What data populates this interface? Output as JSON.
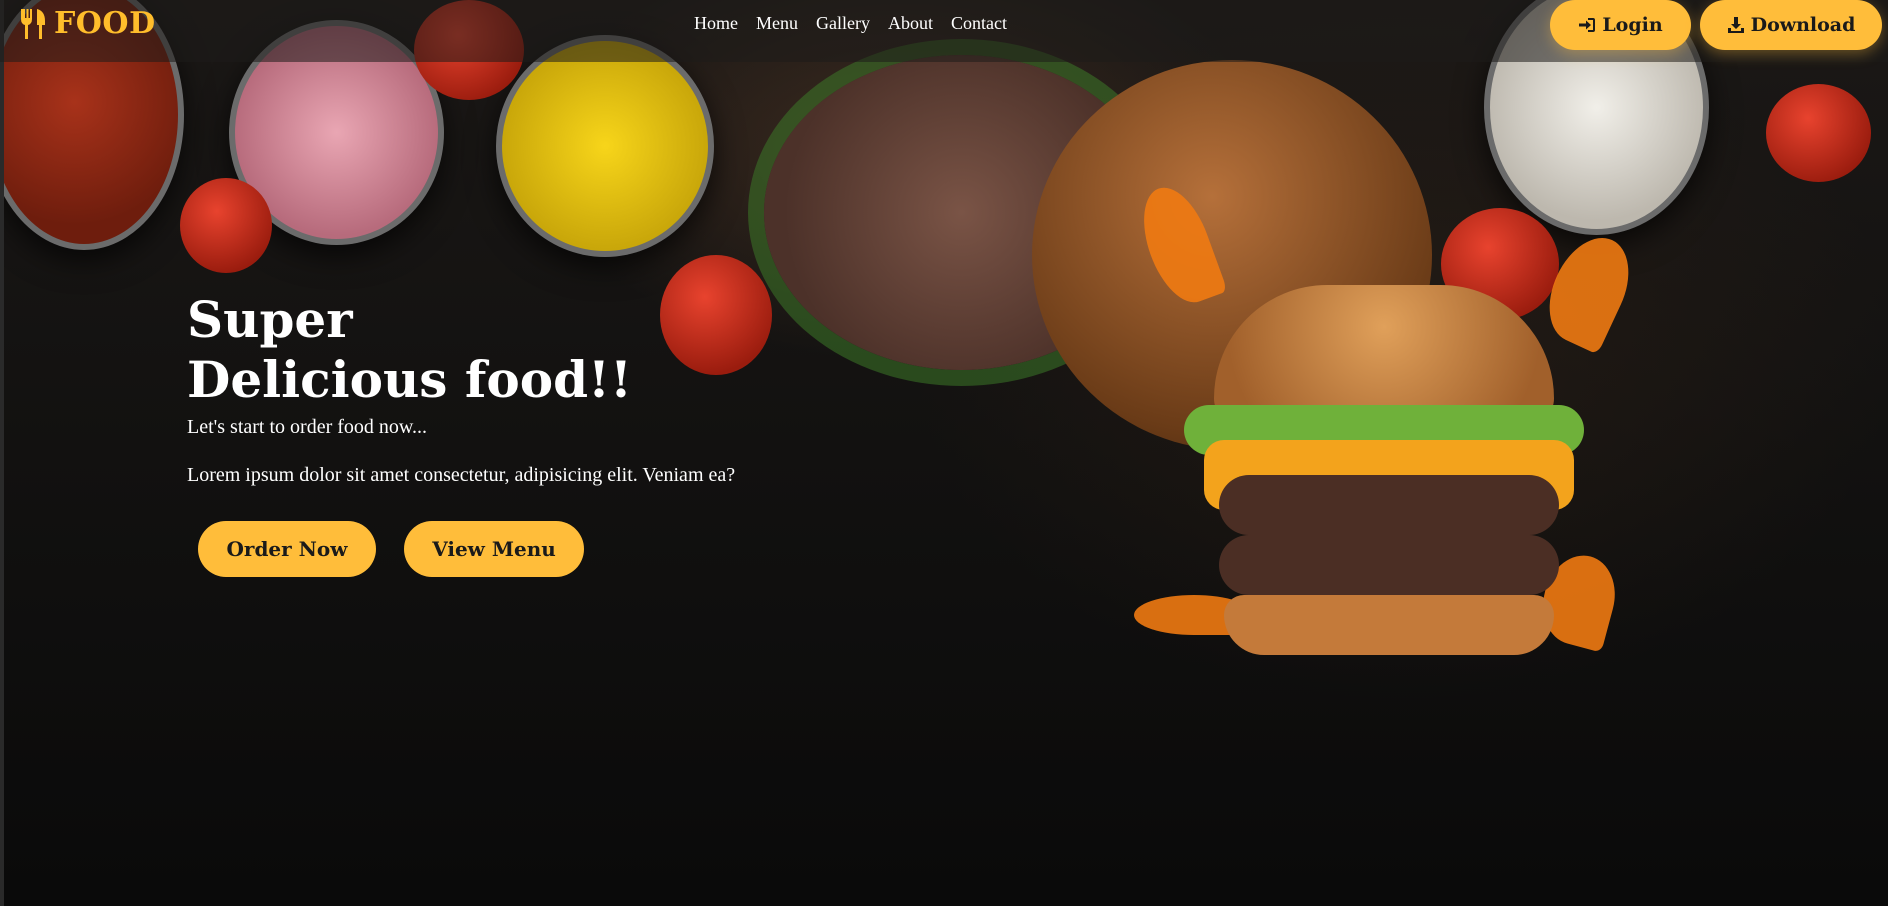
{
  "brand": {
    "name": "FOOD",
    "icon": "utensils-icon",
    "color": "#ffbd2b"
  },
  "nav": {
    "links": [
      {
        "label": "Home"
      },
      {
        "label": "Menu"
      },
      {
        "label": "Gallery"
      },
      {
        "label": "About"
      },
      {
        "label": "Contact"
      }
    ],
    "login_label": "Login",
    "login_icon": "sign-in-icon",
    "download_label": "Download",
    "download_icon": "download-icon"
  },
  "hero": {
    "title_line1": "Super",
    "title_line2": "Delicious food!!",
    "subtitle": "Let's start to order food now...",
    "description": "Lorem ipsum dolor sit amet consectetur, adipisicing elit. Veniam ea?",
    "order_label": "Order Now",
    "menu_label": "View Menu"
  },
  "colors": {
    "accent": "#ffbd3a",
    "background": "#121110",
    "text": "#ffffff"
  }
}
